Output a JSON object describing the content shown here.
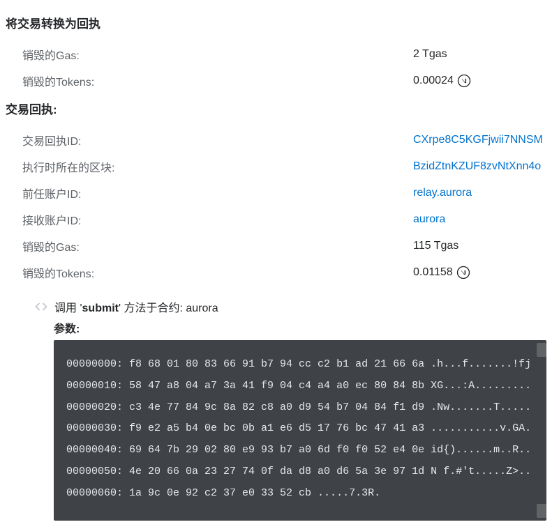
{
  "section_convert_title": "将交易转换为回执",
  "section_receipt_title": "交易回执:",
  "convert": {
    "gas_burnt_label": "销毁的Gas:",
    "gas_burnt_value": "2 Tgas",
    "tokens_burnt_label": "销毁的Tokens:",
    "tokens_burnt_value": "0.00024"
  },
  "receipt": {
    "id_label": "交易回执ID:",
    "id_value": "CXrpe8C5KGFjwii7NNSM",
    "block_label": "执行时所在的区块:",
    "block_value": "BzidZtnKZUF8zvNtXnn4o",
    "predecessor_label": "前任账户ID:",
    "predecessor_value": "relay.aurora",
    "receiver_label": "接收账户ID:",
    "receiver_value": "aurora",
    "gas_burnt_label": "销毁的Gas:",
    "gas_burnt_value": "115 Tgas",
    "tokens_burnt_label": "销毁的Tokens:",
    "tokens_burnt_value": "0.01158"
  },
  "action": {
    "prefix": "调用 '",
    "method": "submit",
    "mid": "' 方法于合约: ",
    "contract": "aurora",
    "args_label": "参数:",
    "hex": "00000000: f8 68 01 80 83 66 91 b7 94 cc c2 b1 ad 21 66 6a .h...f.......!fj 00000010: 58 47 a8 04 a7 3a 41 f9 04 c4 a4 a0 ec 80 84 8b XG...:A......... 00000020: c3 4e 77 84 9c 8a 82 c8 a0 d9 54 b7 04 84 f1 d9 .Nw.......T..... 00000030: f9 e2 a5 b4 0e bc 0b a1 e6 d5 17 76 bc 47 41 a3 ...........v.GA. 00000040: 69 64 7b 29 02 80 e9 93 b7 a0 6d f0 f0 52 e4 0e id{)......m..R.. 00000050: 4e 20 66 0a 23 27 74 0f da d8 a0 d6 5a 3e 97 1d N f.#'t.....Z>.. 00000060: 1a 9c 0e 92 c2 37 e0 33 52 cb .....7.3R."
  }
}
